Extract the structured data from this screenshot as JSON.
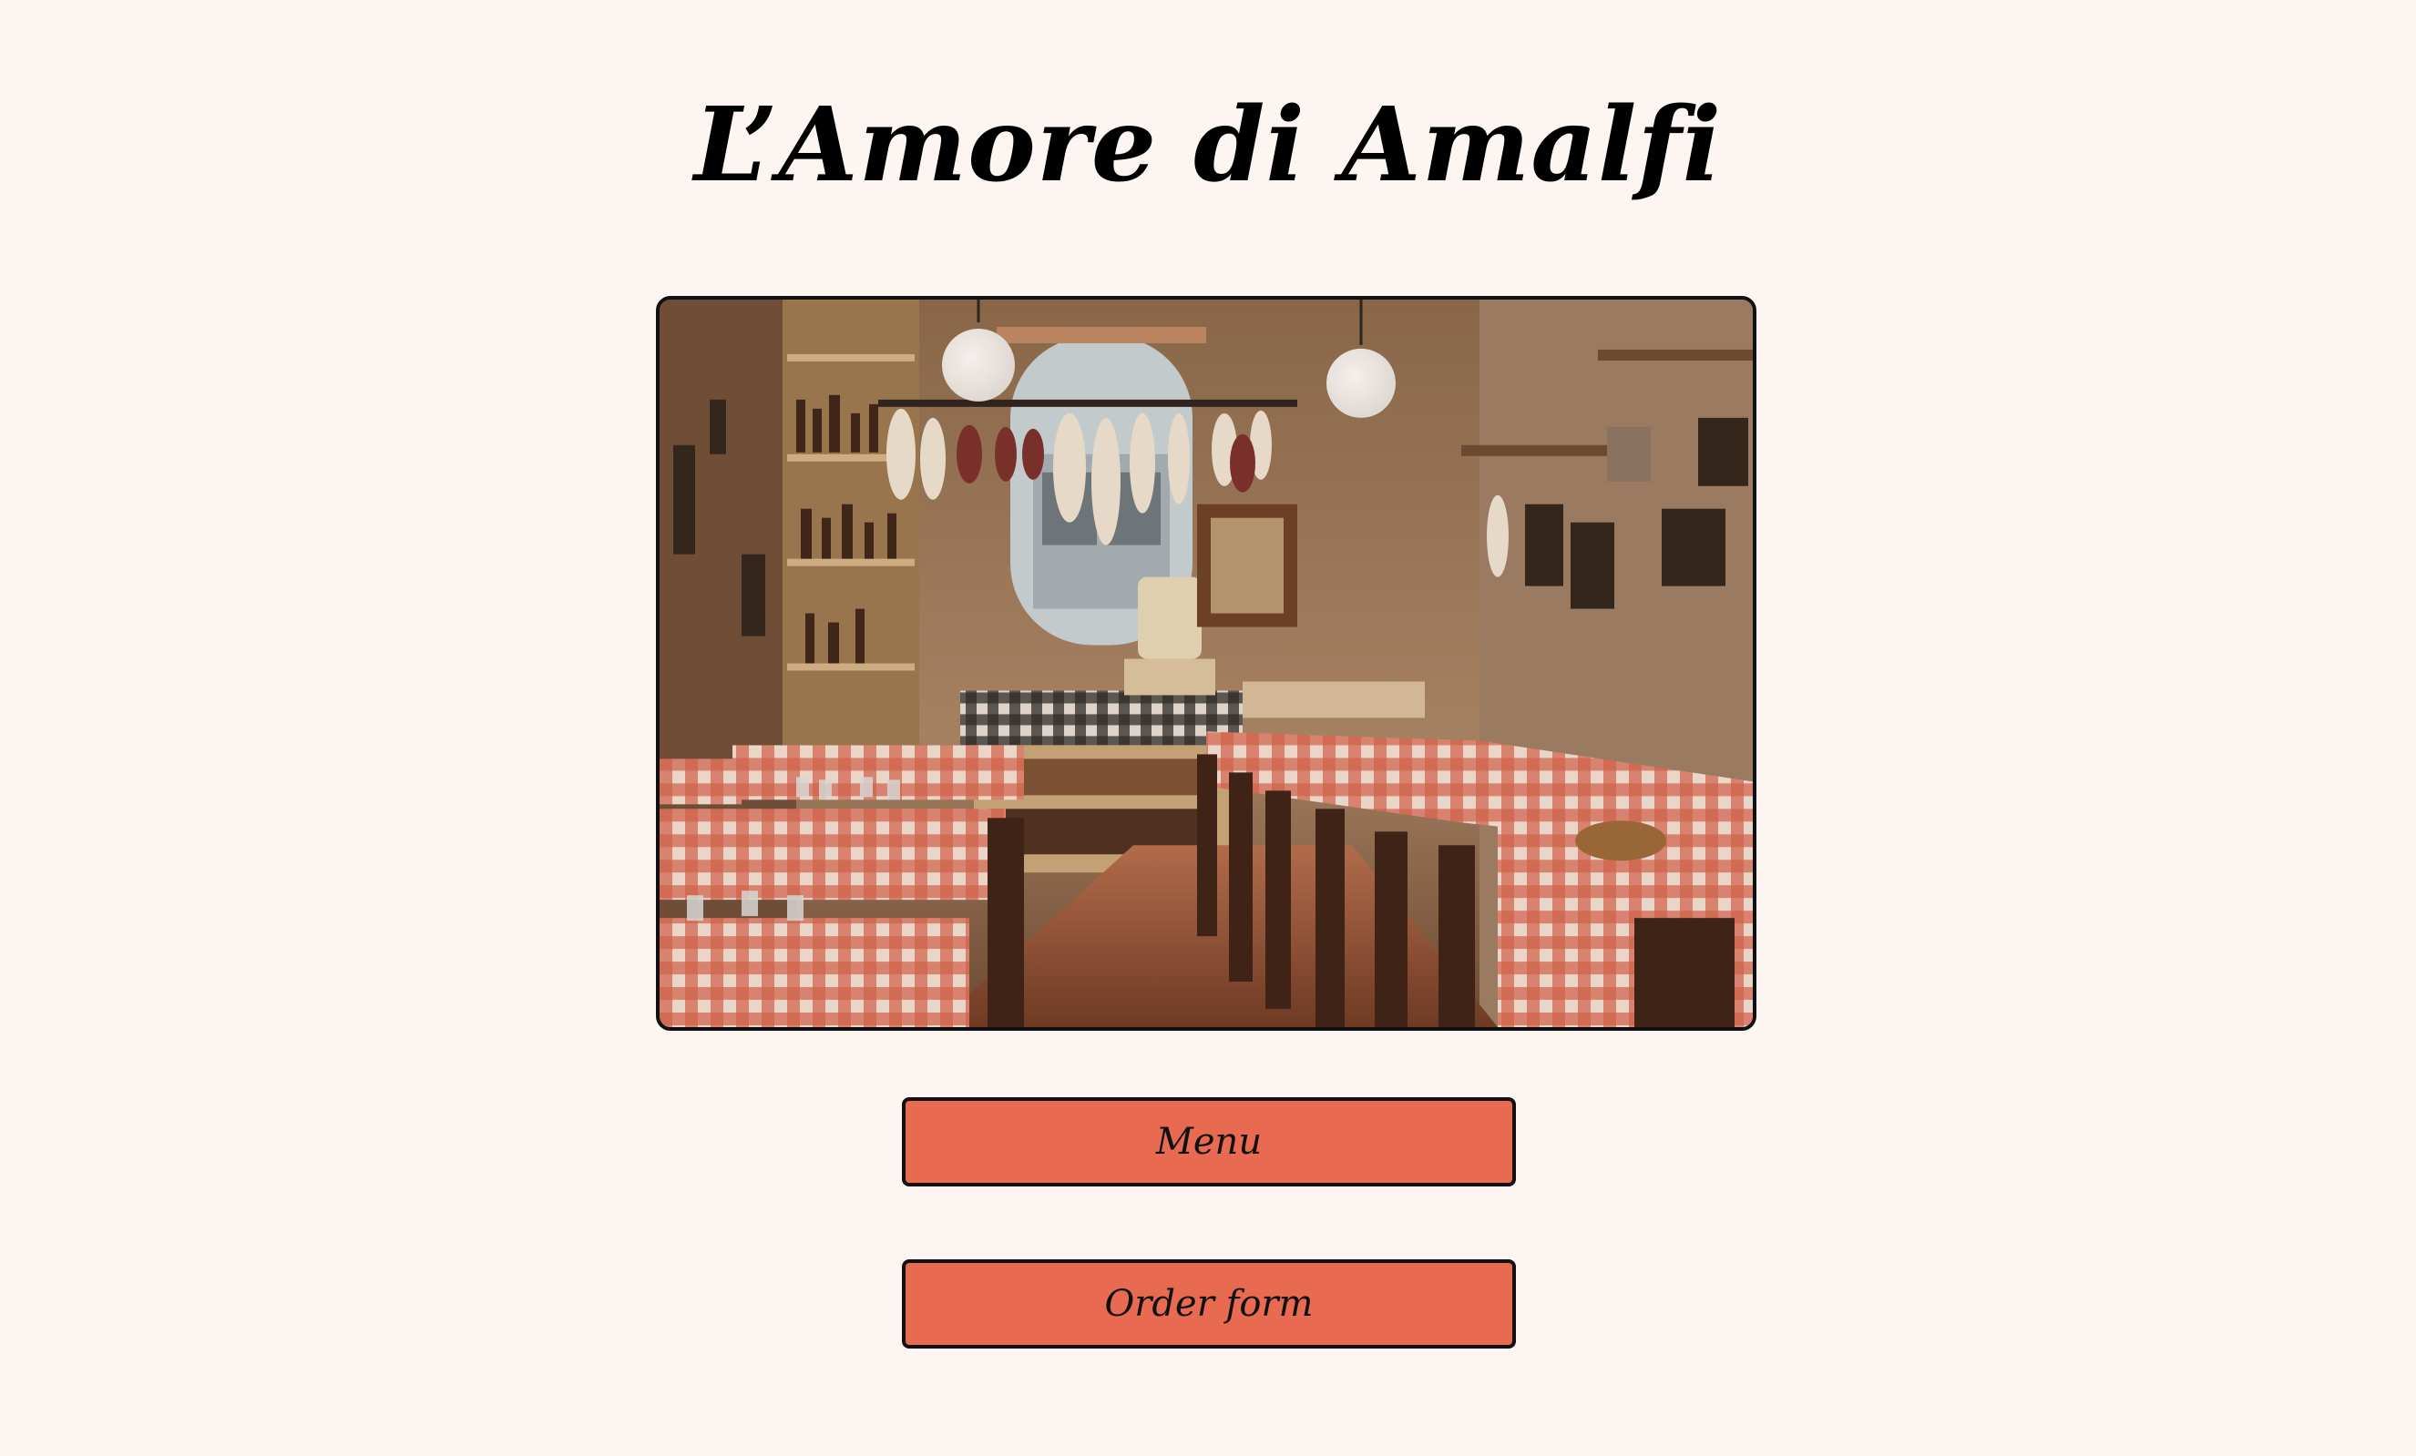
{
  "header": {
    "title": "L’Amore di Amalfi"
  },
  "hero_image": {
    "subject": "restaurant-interior-photo"
  },
  "nav": {
    "menu_label": "Menu",
    "order_form_label": "Order form"
  },
  "colors": {
    "background": "#fdf5f1",
    "button": "#e86a50",
    "border": "#111111",
    "text": "#000000"
  }
}
